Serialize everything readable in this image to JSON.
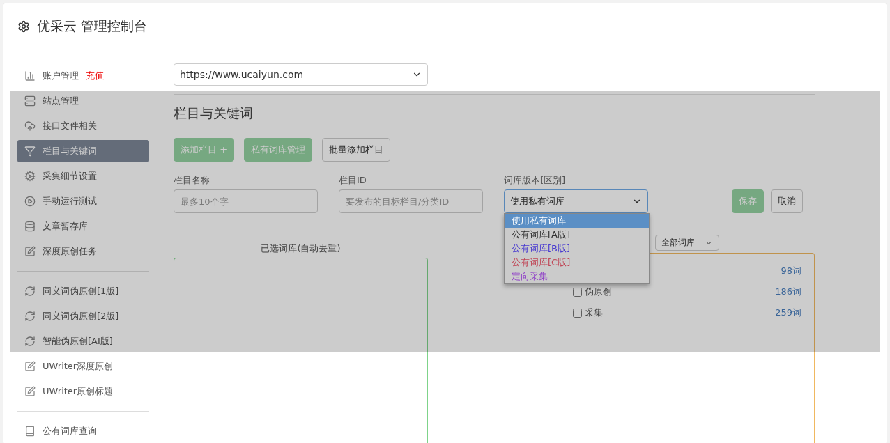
{
  "header": {
    "title": "优采云 管理控制台"
  },
  "sidebar": {
    "groups": [
      {
        "items": [
          {
            "label": "账户管理",
            "badge": "充值",
            "selected": false
          },
          {
            "label": "站点管理",
            "selected": false
          },
          {
            "label": "接口文件相关",
            "selected": false
          },
          {
            "label": "栏目与关键词",
            "selected": true
          },
          {
            "label": "采集细节设置",
            "selected": false
          },
          {
            "label": "手动运行测试",
            "selected": false
          },
          {
            "label": "文章暂存库",
            "selected": false
          },
          {
            "label": "深度原创任务",
            "selected": false
          }
        ]
      },
      {
        "items": [
          {
            "label": "同义词伪原创[1版]",
            "selected": false
          },
          {
            "label": "同义词伪原创[2版]",
            "selected": false
          },
          {
            "label": "智能伪原创[AI版]",
            "selected": false
          },
          {
            "label": "UWriter深度原创",
            "selected": false
          },
          {
            "label": "UWriter原创标题",
            "selected": false
          }
        ]
      },
      {
        "items": [
          {
            "label": "公有词库查询",
            "selected": false
          }
        ]
      }
    ]
  },
  "site_select": {
    "value": "https://www.ucaiyun.com"
  },
  "section_title": "栏目与关键词",
  "toolbar": [
    {
      "label": "添加栏目 +",
      "kind": "primary"
    },
    {
      "label": "私有词库管理",
      "kind": "primary"
    },
    {
      "label": "批量添加栏目",
      "kind": "default"
    }
  ],
  "form": {
    "name": {
      "label": "栏目名称",
      "placeholder": "最多10个字"
    },
    "id": {
      "label": "栏目ID",
      "placeholder": "要发布的目标栏目/分类ID"
    },
    "version": {
      "label": "词库版本[区别]",
      "value": "使用私有词库",
      "expanded": true,
      "options": [
        {
          "label": "使用私有词库",
          "color": "#ffffff",
          "selected": true
        },
        {
          "label": "公有词库[A版]",
          "color": "#333333",
          "selected": false
        },
        {
          "label": "公有词库[B版]",
          "color": "#4a3cd0",
          "selected": false
        },
        {
          "label": "公有词库[C版]",
          "color": "#c04858",
          "selected": false
        },
        {
          "label": "定向采集",
          "color": "#9040c8",
          "selected": false
        }
      ]
    },
    "buttons": [
      {
        "label": "保存",
        "kind": "primary"
      },
      {
        "label": "取消",
        "kind": "default"
      }
    ]
  },
  "selected_panel": {
    "title": "已选词库(自动去重)"
  },
  "library_panel": {
    "filter": "全部词库",
    "rows": [
      {
        "count": "98词"
      },
      {
        "label": "伪原创",
        "count": "186词",
        "checked": false
      },
      {
        "label": "采集",
        "count": "259词",
        "checked": false
      }
    ]
  }
}
